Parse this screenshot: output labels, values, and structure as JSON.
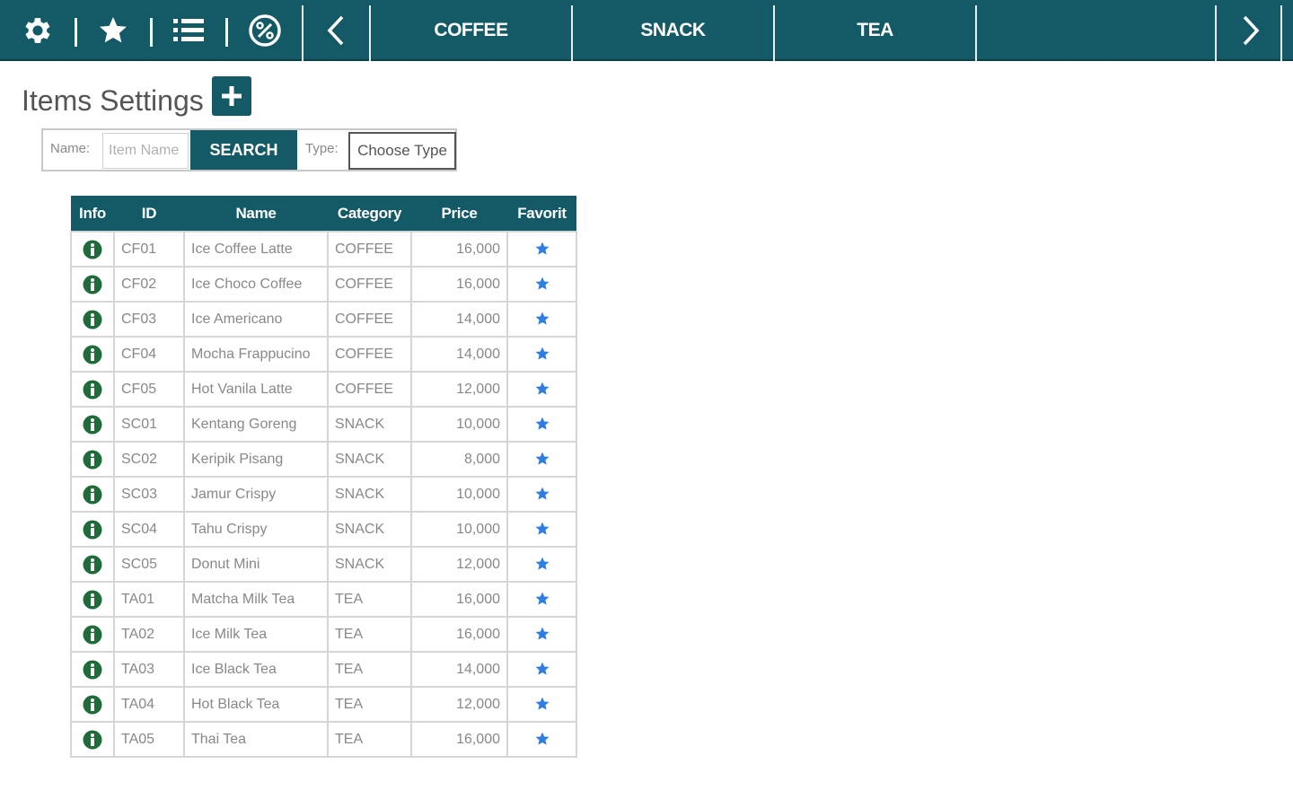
{
  "topbar": {
    "icons": [
      "gear-icon",
      "star-icon",
      "list-icon",
      "discount-icon"
    ],
    "prev": "chevron-left-icon",
    "next": "chevron-right-icon",
    "tabs": [
      {
        "label": "COFFEE"
      },
      {
        "label": "SNACK"
      },
      {
        "label": "TEA"
      }
    ]
  },
  "page": {
    "title": "Items Settings",
    "add_icon": "plus-icon"
  },
  "search": {
    "name_label": "Name:",
    "name_placeholder": "Item Name",
    "button_label": "SEARCH",
    "type_label": "Type:",
    "type_value": "Choose Type"
  },
  "table": {
    "headers": [
      "Info",
      "ID",
      "Name",
      "Category",
      "Price",
      "Favorit"
    ],
    "rows": [
      {
        "id": "CF01",
        "name": "Ice Coffee Latte",
        "category": "COFFEE",
        "price": "16,000"
      },
      {
        "id": "CF02",
        "name": "Ice Choco Coffee",
        "category": "COFFEE",
        "price": "16,000"
      },
      {
        "id": "CF03",
        "name": "Ice Americano",
        "category": "COFFEE",
        "price": "14,000"
      },
      {
        "id": "CF04",
        "name": "Mocha Frappucino",
        "category": "COFFEE",
        "price": "14,000"
      },
      {
        "id": "CF05",
        "name": "Hot Vanila Latte",
        "category": "COFFEE",
        "price": "12,000"
      },
      {
        "id": "SC01",
        "name": "Kentang Goreng",
        "category": "SNACK",
        "price": "10,000"
      },
      {
        "id": "SC02",
        "name": "Keripik Pisang",
        "category": "SNACK",
        "price": "8,000"
      },
      {
        "id": "SC03",
        "name": "Jamur Crispy",
        "category": "SNACK",
        "price": "10,000"
      },
      {
        "id": "SC04",
        "name": "Tahu Crispy",
        "category": "SNACK",
        "price": "10,000"
      },
      {
        "id": "SC05",
        "name": "Donut Mini",
        "category": "SNACK",
        "price": "12,000"
      },
      {
        "id": "TA01",
        "name": "Matcha Milk Tea",
        "category": "TEA",
        "price": "16,000"
      },
      {
        "id": "TA02",
        "name": "Ice Milk Tea",
        "category": "TEA",
        "price": "16,000"
      },
      {
        "id": "TA03",
        "name": "Ice Black Tea",
        "category": "TEA",
        "price": "14,000"
      },
      {
        "id": "TA04",
        "name": "Hot Black Tea",
        "category": "TEA",
        "price": "12,000"
      },
      {
        "id": "TA05",
        "name": "Thai Tea",
        "category": "TEA",
        "price": "16,000"
      }
    ]
  },
  "colors": {
    "primary": "#145a66",
    "info_icon": "#1f6b3a",
    "favorite_star": "#2f7de1"
  }
}
